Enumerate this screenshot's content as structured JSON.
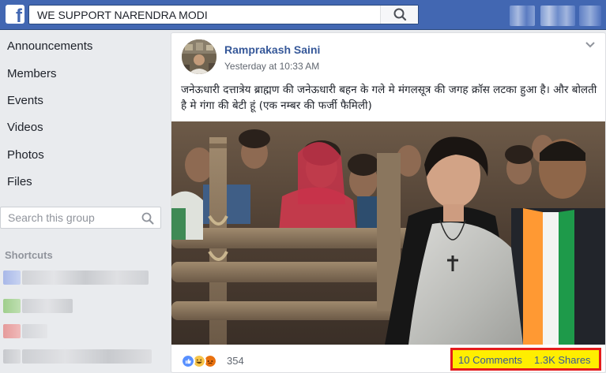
{
  "topbar": {
    "logo": "f",
    "search_value": "WE SUPPORT NARENDRA MODI",
    "search_icon": "search-icon"
  },
  "sidebar": {
    "items": [
      {
        "label": "Announcements"
      },
      {
        "label": "Members"
      },
      {
        "label": "Events"
      },
      {
        "label": "Videos"
      },
      {
        "label": "Photos"
      },
      {
        "label": "Files"
      }
    ],
    "search_placeholder": "Search this group",
    "shortcuts_heading": "Shortcuts"
  },
  "post": {
    "author": "Ramprakash Saini",
    "timestamp": "Yesterday at 10:33 AM",
    "text": "जनेऊधारी दत्तात्रेय ब्राह्मण की जनेऊधारी बहन के गले मे मंगलसूत्र की जगह क्रॉस लटका हुआ है। और बोलती है मे गंगा की बेटी हूं (एक नम्बर की फर्जी फैमिली)",
    "reaction_count": "354",
    "comments": "10 Comments",
    "shares": "1.3K Shares"
  },
  "colors": {
    "brand": "#4267b2",
    "link": "#365899",
    "highlight_fill": "#ffee00",
    "highlight_border": "#e41b1b"
  }
}
